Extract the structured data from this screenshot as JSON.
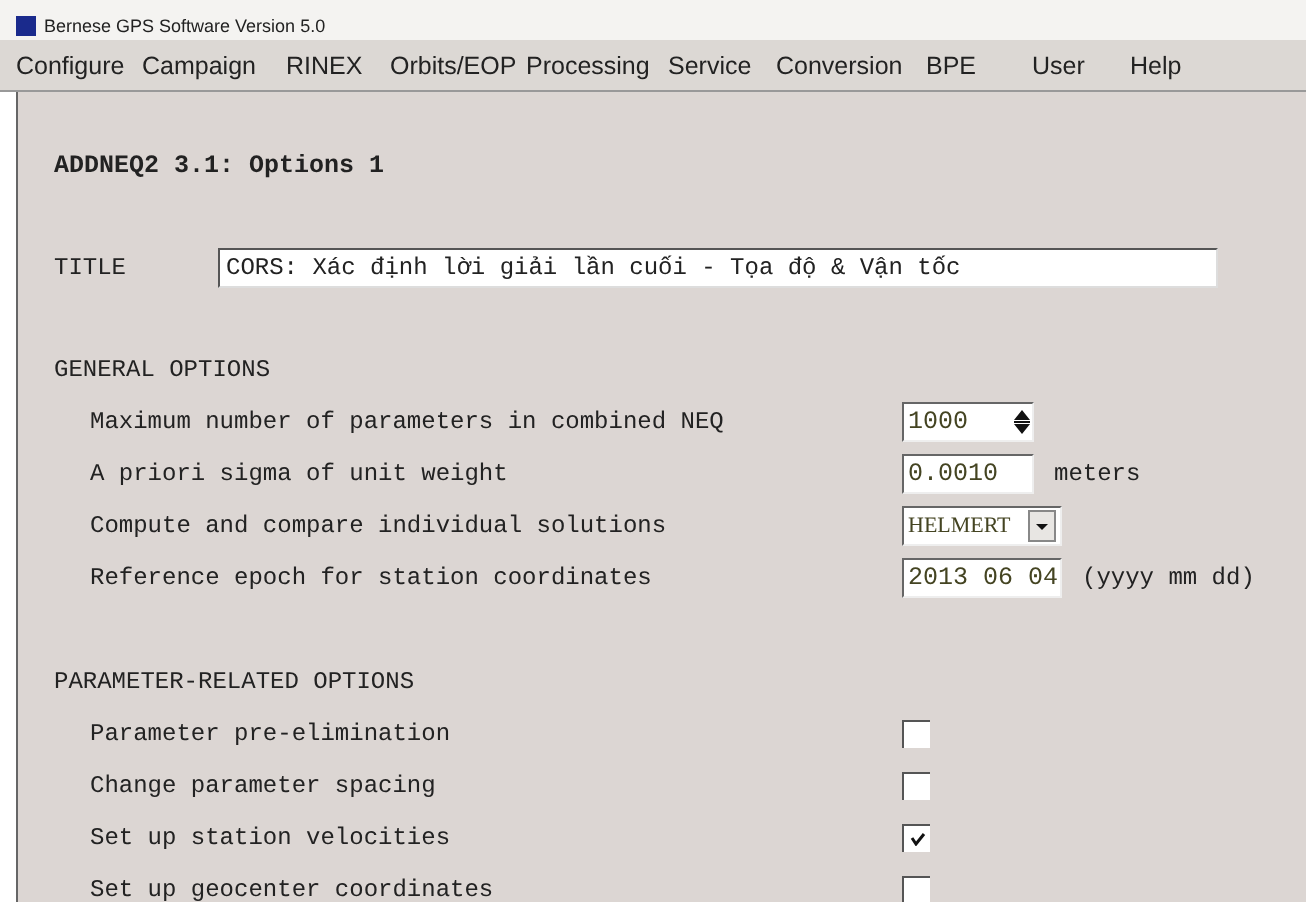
{
  "window": {
    "title": "Bernese GPS Software Version 5.0"
  },
  "menu": [
    "Configure",
    "Campaign",
    "RINEX",
    "Orbits/EOP",
    "Processing",
    "Service",
    "Conversion",
    "BPE",
    "User",
    "Help"
  ],
  "panel_title": "ADDNEQ2 3.1: Options 1",
  "title_field": {
    "label": "TITLE",
    "value": "CORS: Xác định lời giải lần cuối - Tọa độ & Vận tốc"
  },
  "general_options": {
    "heading": "GENERAL OPTIONS",
    "rows": [
      {
        "kind": "spin",
        "label": "Maximum number of parameters in combined NEQ",
        "value": "1000"
      },
      {
        "kind": "text",
        "label": "A priori sigma of unit weight",
        "value": "0.0010",
        "unit": "meters"
      },
      {
        "kind": "dropdown",
        "label": "Compute and compare individual solutions",
        "value": "HELMERT"
      },
      {
        "kind": "text",
        "label": "Reference epoch for station coordinates",
        "value": "2013 06 04",
        "unit": "(yyyy mm dd)"
      }
    ]
  },
  "parameter_options": {
    "heading": "PARAMETER-RELATED OPTIONS",
    "rows": [
      {
        "label": "Parameter pre-elimination",
        "checked": false
      },
      {
        "label": "Change parameter spacing",
        "checked": false
      },
      {
        "label": "Set up station velocities",
        "checked": true
      },
      {
        "label": "Set up geocenter coordinates",
        "checked": false
      }
    ]
  }
}
